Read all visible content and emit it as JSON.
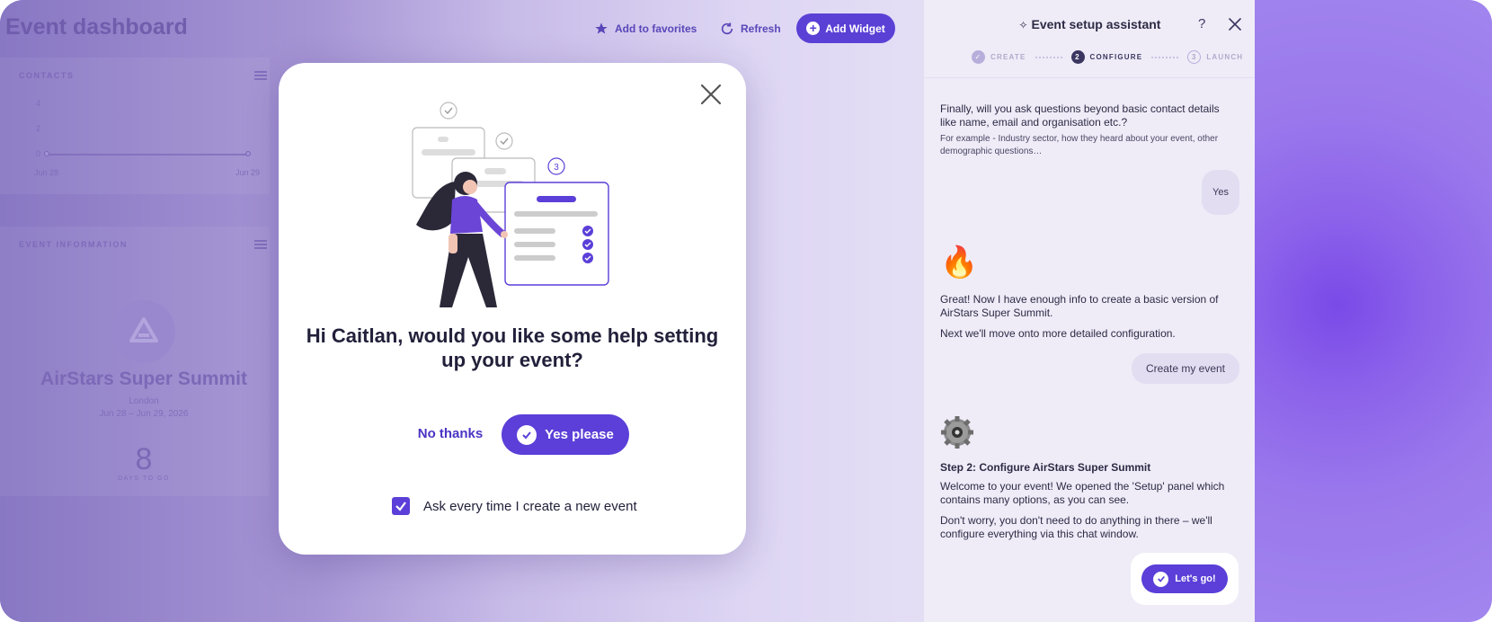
{
  "dashboard": {
    "title": "Event dashboard",
    "header": {
      "favorites_label": "Add to favorites",
      "refresh_label": "Refresh",
      "add_widget_label": "Add Widget"
    },
    "contacts_card": {
      "label": "CONTACTS",
      "y_ticks": [
        "4",
        "2",
        "0"
      ],
      "x_ticks": [
        "Jun 28",
        "Jun 29"
      ]
    },
    "event_info_card": {
      "label": "EVENT INFORMATION",
      "event_name": "AirStars Super Summit",
      "location": "London",
      "dates": "Jun 28 – Jun 29, 2026",
      "days_value": "8",
      "days_label": "DAYS TO GO"
    }
  },
  "modal": {
    "title": "Hi Caitlan, would you like some help setting up your event?",
    "no_label": "No thanks",
    "yes_label": "Yes please",
    "checkbox_label": "Ask every time I create a new event",
    "checkbox_checked": true,
    "illustration_step_number": "3"
  },
  "assistant": {
    "title": "Event setup assistant",
    "help_symbol": "?",
    "steps": [
      {
        "num": "✓",
        "label": "CREATE",
        "state": "done"
      },
      {
        "num": "2",
        "label": "CONFIGURE",
        "state": "active"
      },
      {
        "num": "3",
        "label": "LAUNCH",
        "state": "pending"
      }
    ],
    "messages": {
      "q1": "Finally, will you ask questions beyond basic contact details like name, email and organisation etc.?",
      "q1_sub": "For example - Industry sector, how they heard about your event, other demographic questions…",
      "reply_yes": "Yes",
      "m2_line1": "Great! Now I have enough info to create a basic version of AirStars Super Summit.",
      "m2_line2": "Next we'll move onto more detailed configuration.",
      "create_btn": "Create my event",
      "step2_title": "Step 2: Configure AirStars Super Summit",
      "step2_p1": "Welcome to your event! We opened the 'Setup' panel which contains many options, as you can see.",
      "step2_p2": "Don't worry, you don't need to do anything in there – we'll configure everything via this chat window.",
      "lets_go": "Let's go!"
    }
  },
  "colors": {
    "accent": "#5b3fd8",
    "panel_bg": "#efecf8",
    "text_dark": "#22203a"
  }
}
